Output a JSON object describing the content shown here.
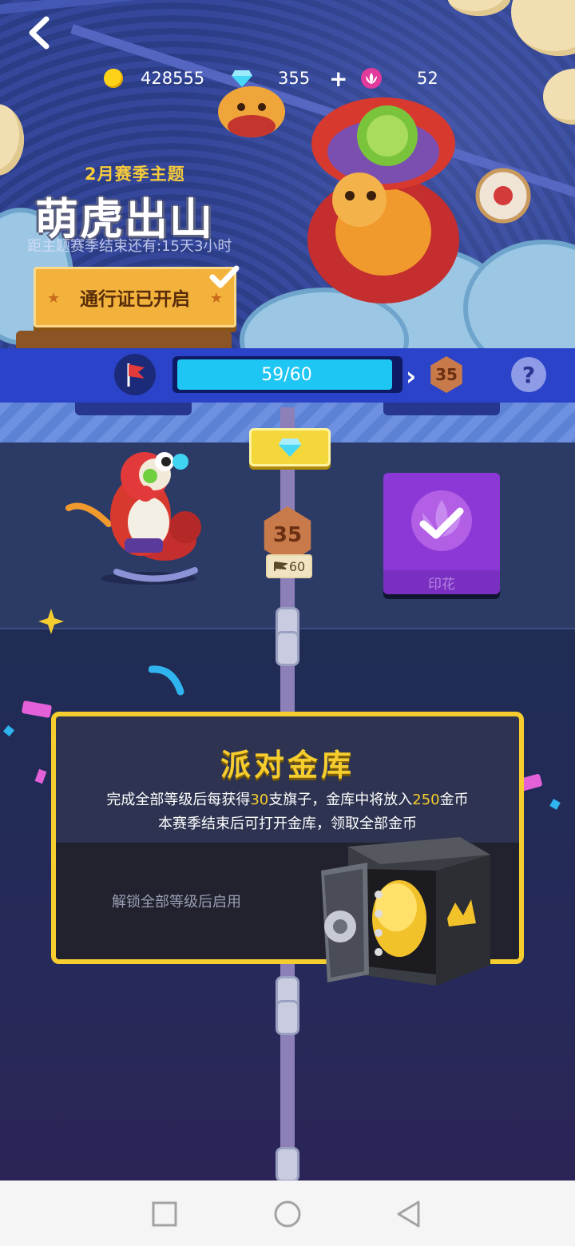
{
  "header": {
    "back_icon": "chevron-left-icon",
    "coins": "428555",
    "gems": "355",
    "add_symbol": "+",
    "stamps": "52"
  },
  "season": {
    "subtitle": "2月赛季主题",
    "title": "萌虎出山",
    "countdown": "距主题赛季结束还有:15天3小时",
    "pass_button": "通行证已开启"
  },
  "progress": {
    "value": "59/60",
    "fraction": 0.983,
    "next_level": "35"
  },
  "track": {
    "level": "35",
    "requirement": "60",
    "reward_label": "印花",
    "reward_claimed": true
  },
  "vault": {
    "title": "派对金库",
    "line1_a": "完成全部等级后每获得",
    "line1_num1": "30",
    "line1_b": "支旗子，金库中将放入",
    "line1_num2": "250",
    "line1_c": "金币",
    "line2": "本赛季结束后可打开金库，领取全部金币",
    "locked_text": "解锁全部等级后启用"
  },
  "colors": {
    "accent_yellow": "#f6cd2e",
    "progress_fill": "#1ec6f4",
    "header_blue": "#2a43c9",
    "reward_purple": "#8c38d6"
  }
}
